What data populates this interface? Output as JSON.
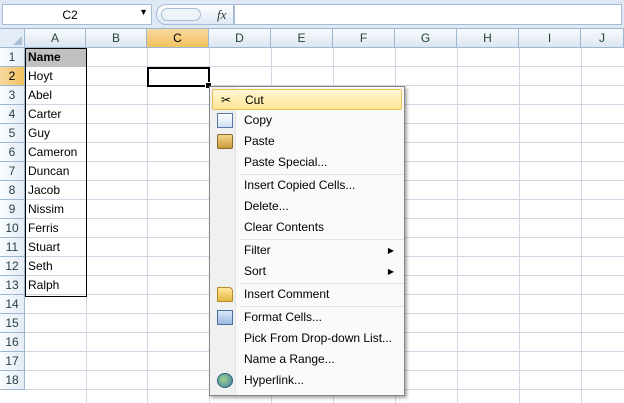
{
  "formula_bar": {
    "name_box": "C2",
    "fx_label": "fx",
    "formula": ""
  },
  "columns": [
    "A",
    "B",
    "C",
    "D",
    "E",
    "F",
    "G",
    "H",
    "I",
    "J"
  ],
  "selected_column": "C",
  "rows": [
    "1",
    "2",
    "3",
    "4",
    "5",
    "6",
    "7",
    "8",
    "9",
    "10",
    "11",
    "12",
    "13",
    "14",
    "15",
    "16",
    "17",
    "18"
  ],
  "selected_row": "2",
  "cells_a": [
    "Name",
    "Hoyt",
    "Abel",
    "Carter",
    "Guy",
    "Cameron",
    "Duncan",
    "Jacob",
    "Nissim",
    "Ferris",
    "Stuart",
    "Seth",
    "Ralph"
  ],
  "context_menu": {
    "items": [
      {
        "label": "Cut",
        "icon": "scissors-icon"
      },
      {
        "label": "Copy",
        "icon": "copy-icon"
      },
      {
        "label": "Paste",
        "icon": "paste-icon"
      },
      {
        "label": "Paste Special..."
      },
      {
        "label": "Insert Copied Cells..."
      },
      {
        "label": "Delete..."
      },
      {
        "label": "Clear Contents"
      },
      {
        "label": "Filter",
        "submenu": true
      },
      {
        "label": "Sort",
        "submenu": true
      },
      {
        "label": "Insert Comment",
        "icon": "comment-icon"
      },
      {
        "label": "Format Cells...",
        "icon": "format-cells-icon"
      },
      {
        "label": "Pick From Drop-down List..."
      },
      {
        "label": "Name a Range..."
      },
      {
        "label": "Hyperlink...",
        "icon": "hyperlink-icon"
      }
    ],
    "submenu_arrow": "▶",
    "highlighted": "Cut"
  },
  "colors": {
    "selected_header": "#f1c15f",
    "gridline": "#d0d7e5",
    "header_border": "#9eb6ce",
    "highlight": "#ffe694"
  }
}
